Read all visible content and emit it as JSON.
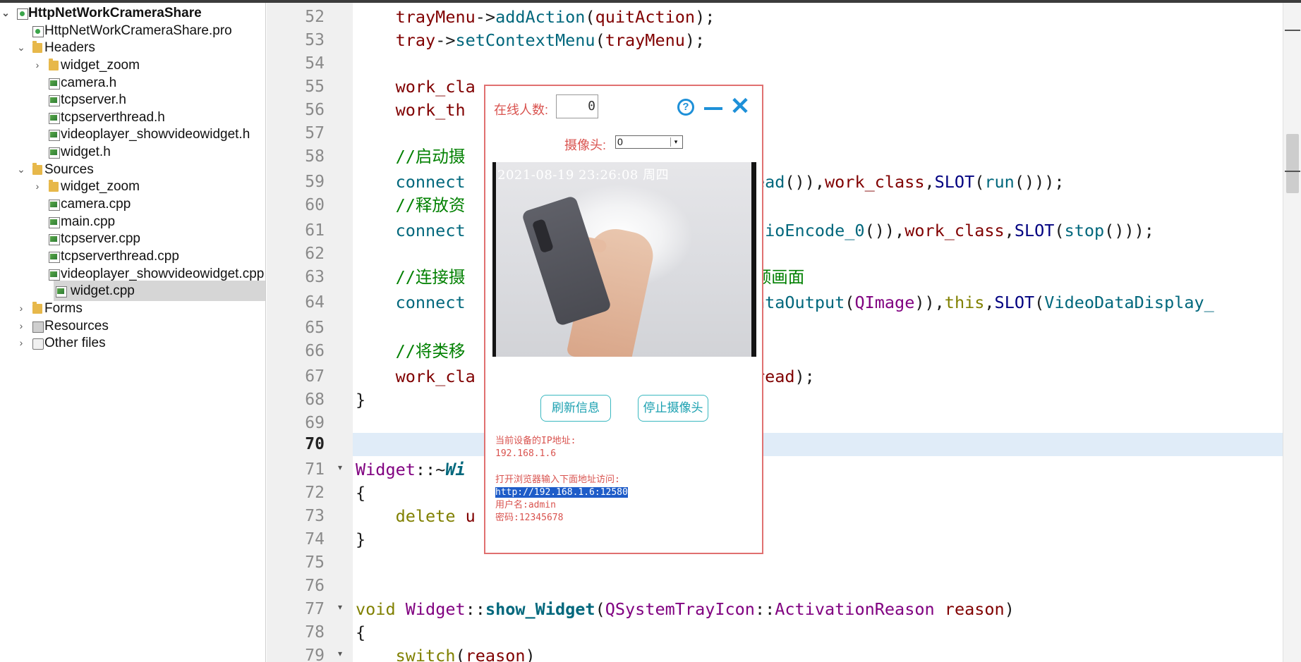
{
  "project_tree": {
    "items": [
      {
        "label": "HttpNetWorkCrameraShare",
        "icon": "project-icon",
        "arrow": "⌄"
      },
      {
        "label": "HttpNetWorkCrameraShare.pro",
        "icon": "pro-file-icon",
        "arrow": ""
      },
      {
        "label": "Headers",
        "icon": "folder-icon",
        "arrow": "⌄"
      },
      {
        "label": "widget_zoom",
        "icon": "folder-icon",
        "arrow": "›"
      },
      {
        "label": "camera.h",
        "icon": "header-file-icon",
        "arrow": ""
      },
      {
        "label": "tcpserver.h",
        "icon": "header-file-icon",
        "arrow": ""
      },
      {
        "label": "tcpserverthread.h",
        "icon": "header-file-icon",
        "arrow": ""
      },
      {
        "label": "videoplayer_showvideowidget.h",
        "icon": "header-file-icon",
        "arrow": ""
      },
      {
        "label": "widget.h",
        "icon": "header-file-icon",
        "arrow": ""
      },
      {
        "label": "Sources",
        "icon": "folder-icon",
        "arrow": "⌄"
      },
      {
        "label": "widget_zoom",
        "icon": "folder-icon",
        "arrow": "›"
      },
      {
        "label": "camera.cpp",
        "icon": "source-file-icon",
        "arrow": ""
      },
      {
        "label": "main.cpp",
        "icon": "source-file-icon",
        "arrow": ""
      },
      {
        "label": "tcpserver.cpp",
        "icon": "source-file-icon",
        "arrow": ""
      },
      {
        "label": "tcpserverthread.cpp",
        "icon": "source-file-icon",
        "arrow": ""
      },
      {
        "label": "videoplayer_showvideowidget.cpp",
        "icon": "source-file-icon",
        "arrow": ""
      },
      {
        "label": "widget.cpp",
        "icon": "source-file-icon",
        "arrow": "",
        "selected": true
      },
      {
        "label": "Forms",
        "icon": "folder-icon",
        "arrow": "›"
      },
      {
        "label": "Resources",
        "icon": "resources-icon",
        "arrow": "›"
      },
      {
        "label": "Other files",
        "icon": "other-files-icon",
        "arrow": "›"
      }
    ]
  },
  "editor": {
    "current_line": "70",
    "line_numbers": [
      "52",
      "53",
      "54",
      "55",
      "56",
      "57",
      "58",
      "59",
      "60",
      "61",
      "62",
      "63",
      "64",
      "65",
      "66",
      "67",
      "68",
      "69",
      "70",
      "71",
      "72",
      "73",
      "74",
      "75",
      "76",
      "77",
      "78",
      "79"
    ],
    "fold_markers": {
      "71": "▾",
      "77": "▾",
      "79": "▾"
    }
  },
  "dialog": {
    "online_label": "在线人数:",
    "online_count": "0",
    "help_glyph": "?",
    "close_glyph": "✕",
    "camera_label": "摄像头:",
    "camera_selected": "0",
    "dropdown_glyph": "▾",
    "video_timestamp": "2021-08-19 23:26:08 周四",
    "refresh_button": "刷新信息",
    "stop_camera_button": "停止摄像头",
    "ip_label": "当前设备的IP地址:",
    "ip_value": "192.168.1.6",
    "browser_hint": "打开浏览器输入下面地址访问:",
    "url": "http://192.168.1.6:12580",
    "username": "用户名:admin",
    "password": "密码:12345678"
  },
  "colors": {
    "dialog_border": "#e07070",
    "label_red": "#d9534f",
    "icon_blue": "#1e90d8",
    "button_teal": "#3ab8c0",
    "current_line_bg": "#e0ecf8",
    "selection_bg": "#1e5cc8"
  }
}
